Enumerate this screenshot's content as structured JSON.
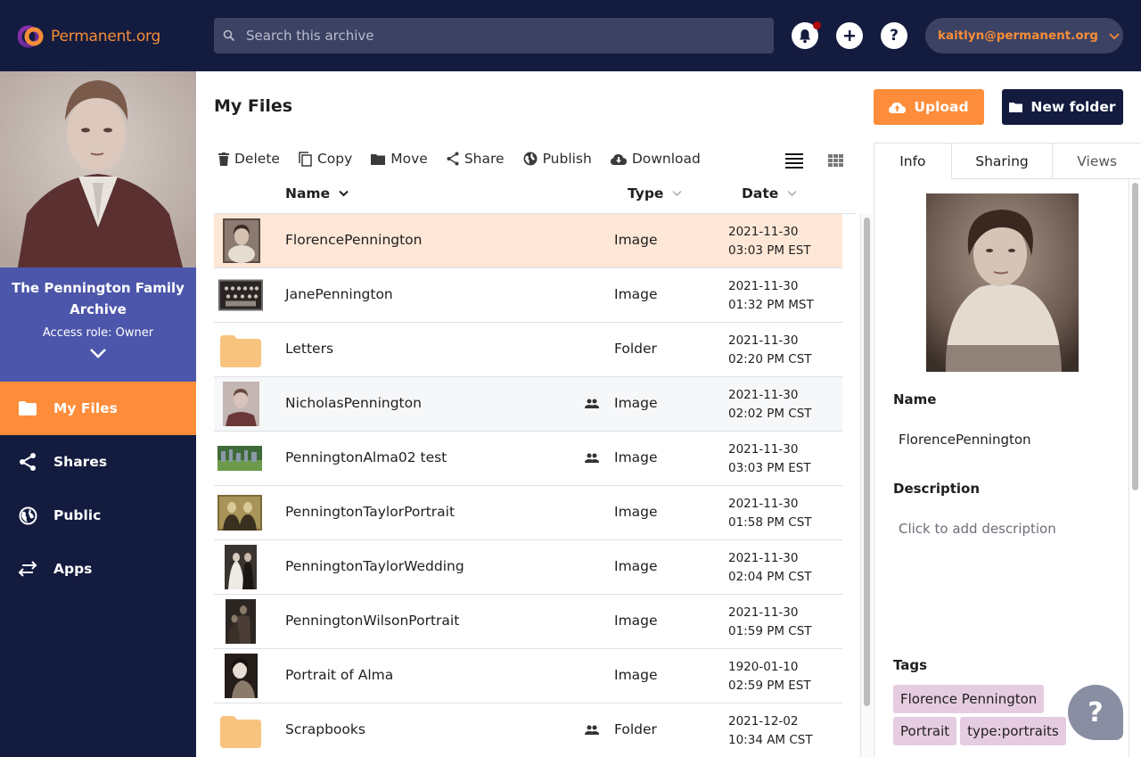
{
  "header": {
    "brand": "Permanent.org",
    "search_placeholder": "Search this archive",
    "account_email": "kaitlyn@permanent.org",
    "colors": {
      "bg": "#131b3f",
      "accent": "#f68d38",
      "search_bg": "#3c4264",
      "notification": "#b00b0b"
    }
  },
  "sidebar": {
    "archive_name": "The Pennington Family Archive",
    "access_role": "Access role: Owner",
    "items": [
      {
        "label": "My Files",
        "icon": "folder-icon",
        "active": true
      },
      {
        "label": "Shares",
        "icon": "share-icon",
        "active": false
      },
      {
        "label": "Public",
        "icon": "globe-icon",
        "active": false
      },
      {
        "label": "Apps",
        "icon": "arrows-icon",
        "active": false
      }
    ],
    "colors": {
      "card_bg": "#4c56aa",
      "active_bg": "#fd8d3a"
    }
  },
  "main": {
    "title": "My Files",
    "toolbar": {
      "delete": "Delete",
      "copy": "Copy",
      "move": "Move",
      "share": "Share",
      "publish": "Publish",
      "download": "Download"
    },
    "upload_label": "Upload",
    "new_folder_label": "New folder",
    "columns": {
      "name": "Name",
      "type": "Type",
      "date": "Date"
    },
    "rows": [
      {
        "name": "FlorencePennington",
        "type": "Image",
        "date": "2021-11-30",
        "time": "03:03 PM EST",
        "shared": false,
        "selected": true,
        "thumb": "portrait-woman"
      },
      {
        "name": "JanePennington",
        "type": "Image",
        "date": "2021-11-30",
        "time": "01:32 PM MST",
        "shared": false,
        "thumb": "group-photo"
      },
      {
        "name": "Letters",
        "type": "Folder",
        "date": "2021-11-30",
        "time": "02:20 PM CST",
        "shared": false,
        "thumb": "folder"
      },
      {
        "name": "NicholasPennington",
        "type": "Image",
        "date": "2021-11-30",
        "time": "02:02 PM CST",
        "shared": true,
        "hover": true,
        "thumb": "portrait-man"
      },
      {
        "name": "PenningtonAlma02 test",
        "type": "Image",
        "date": "2021-11-30",
        "time": "03:03 PM EST",
        "shared": true,
        "thumb": "cemetery"
      },
      {
        "name": "PenningtonTaylorPortrait",
        "type": "Image",
        "date": "2021-11-30",
        "time": "01:58 PM CST",
        "shared": false,
        "thumb": "couple"
      },
      {
        "name": "PenningtonTaylorWedding",
        "type": "Image",
        "date": "2021-11-30",
        "time": "02:04 PM CST",
        "shared": false,
        "thumb": "wedding"
      },
      {
        "name": "PenningtonWilsonPortrait",
        "type": "Image",
        "date": "2021-11-30",
        "time": "01:59 PM CST",
        "shared": false,
        "thumb": "dark-portrait"
      },
      {
        "name": "Portrait of Alma",
        "type": "Image",
        "date": "1920-01-10",
        "time": "02:59 PM EST",
        "shared": false,
        "thumb": "portrait-alma"
      },
      {
        "name": "Scrapbooks",
        "type": "Folder",
        "date": "2021-12-02",
        "time": "10:34 AM CST",
        "shared": true,
        "thumb": "folder"
      }
    ]
  },
  "panel": {
    "tabs": [
      {
        "label": "Info",
        "active": true
      },
      {
        "label": "Sharing",
        "active": false
      },
      {
        "label": "Views",
        "active": false
      }
    ],
    "name_label": "Name",
    "name_value": "FlorencePennington",
    "description_label": "Description",
    "description_placeholder": "Click to add description",
    "tags_label": "Tags",
    "tags": [
      "Florence Pennington",
      "Portrait",
      "type:portraits"
    ],
    "tag_color": "#e6cce1"
  },
  "help_button": "?"
}
